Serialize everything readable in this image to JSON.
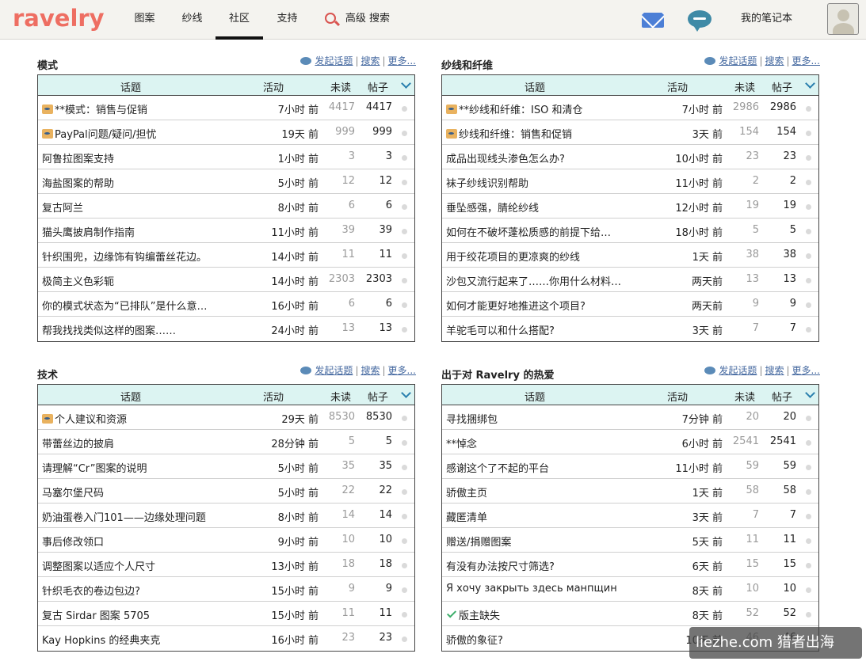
{
  "header": {
    "logo": "ravelry",
    "nav": [
      "图案",
      "纱线",
      "社区",
      "支持"
    ],
    "search_label": "高级 搜索",
    "notebook": "我的笔记本"
  },
  "links": {
    "start": "发起话题",
    "search": "搜索",
    "more": "更多..."
  },
  "cols": {
    "topic": "话题",
    "activity": "活动",
    "unread": "未读",
    "posts": "帖子"
  },
  "sections": [
    {
      "title": "模式",
      "rows": [
        {
          "t": "**模式：销售与促销",
          "a": "7小时 前",
          "u": "4417",
          "p": "4417",
          "pin": true
        },
        {
          "t": "PayPal问题/疑问/担忧",
          "a": "19天 前",
          "u": "999",
          "p": "999",
          "pin": true
        },
        {
          "t": "阿鲁拉图案支持",
          "a": "1小时 前",
          "u": "3",
          "p": "3"
        },
        {
          "t": "海盐图案的帮助",
          "a": "5小时 前",
          "u": "12",
          "p": "12"
        },
        {
          "t": "复古阿兰",
          "a": "8小时 前",
          "u": "6",
          "p": "6"
        },
        {
          "t": "猫头鹰披肩制作指南",
          "a": "11小时 前",
          "u": "39",
          "p": "39"
        },
        {
          "t": "针织围兜，边缘饰有钩编蕾丝花边。",
          "a": "14小时 前",
          "u": "11",
          "p": "11"
        },
        {
          "t": "极简主义色彩轭",
          "a": "14小时 前",
          "u": "2303",
          "p": "2303"
        },
        {
          "t": "你的模式状态为“已排队”是什么意…",
          "a": "16小时 前",
          "u": "6",
          "p": "6"
        },
        {
          "t": "帮我找找类似这样的图案……",
          "a": "24小时 前",
          "u": "13",
          "p": "13"
        }
      ]
    },
    {
      "title": "纱线和纤维",
      "rows": [
        {
          "t": "**纱线和纤维：ISO 和清仓",
          "a": "7小时 前",
          "u": "2986",
          "p": "2986",
          "pin": true
        },
        {
          "t": "纱线和纤维：销售和促销",
          "a": "3天 前",
          "u": "154",
          "p": "154",
          "pin": true
        },
        {
          "t": "成品出现线头渗色怎么办?",
          "a": "10小时 前",
          "u": "23",
          "p": "23"
        },
        {
          "t": "袜子纱线识别帮助",
          "a": "11小时 前",
          "u": "2",
          "p": "2"
        },
        {
          "t": "垂坠感强，腈纶纱线",
          "a": "12小时 前",
          "u": "19",
          "p": "19"
        },
        {
          "t": "如何在不破坏蓬松质感的前提下给…",
          "a": "18小时 前",
          "u": "5",
          "p": "5"
        },
        {
          "t": "用于绞花项目的更凉爽的纱线",
          "a": "1天 前",
          "u": "38",
          "p": "38"
        },
        {
          "t": "沙包又流行起来了……你用什么材料…",
          "a": "两天前",
          "u": "13",
          "p": "13"
        },
        {
          "t": "如何才能更好地推进这个项目?",
          "a": "两天前",
          "u": "9",
          "p": "9"
        },
        {
          "t": "羊驼毛可以和什么搭配?",
          "a": "3天 前",
          "u": "7",
          "p": "7"
        }
      ]
    },
    {
      "title": "技术",
      "rows": [
        {
          "t": "个人建议和资源",
          "a": "29天 前",
          "u": "8530",
          "p": "8530",
          "pin": true
        },
        {
          "t": "带蕾丝边的披肩",
          "a": "28分钟 前",
          "u": "5",
          "p": "5"
        },
        {
          "t": "请理解“Cr”图案的说明",
          "a": "5小时 前",
          "u": "35",
          "p": "35"
        },
        {
          "t": "马塞尔堡尺码",
          "a": "5小时 前",
          "u": "22",
          "p": "22"
        },
        {
          "t": "奶油蛋卷入门101——边缘处理问题",
          "a": "8小时 前",
          "u": "14",
          "p": "14"
        },
        {
          "t": "事后修改领口",
          "a": "9小时 前",
          "u": "10",
          "p": "10"
        },
        {
          "t": "调整图案以适应个人尺寸",
          "a": "13小时 前",
          "u": "18",
          "p": "18"
        },
        {
          "t": "针织毛衣的卷边包边?",
          "a": "15小时 前",
          "u": "9",
          "p": "9"
        },
        {
          "t": "复古 Sirdar 图案 5705",
          "a": "15小时 前",
          "u": "11",
          "p": "11"
        },
        {
          "t": "Kay Hopkins 的经典夹克",
          "a": "16小时 前",
          "u": "23",
          "p": "23"
        }
      ]
    },
    {
      "title": "出于对 Ravelry 的热爱",
      "rows": [
        {
          "t": "寻找捆绑包",
          "a": "7分钟 前",
          "u": "20",
          "p": "20"
        },
        {
          "t": "**悼念",
          "a": "6小时 前",
          "u": "2541",
          "p": "2541"
        },
        {
          "t": "感谢这个了不起的平台",
          "a": "11小时 前",
          "u": "59",
          "p": "59"
        },
        {
          "t": "骄傲主页",
          "a": "1天 前",
          "u": "58",
          "p": "58"
        },
        {
          "t": "藏匿清单",
          "a": "3天 前",
          "u": "7",
          "p": "7"
        },
        {
          "t": "赠送/捐赠图案",
          "a": "5天 前",
          "u": "11",
          "p": "11"
        },
        {
          "t": "有没有办法按尺寸筛选?",
          "a": "6天 前",
          "u": "15",
          "p": "15"
        },
        {
          "t": "Я хочу закрыть здесь манпщин",
          "a": "8天 前",
          "u": "10",
          "p": "10"
        },
        {
          "t": "版主缺失",
          "a": "8天 前",
          "u": "52",
          "p": "52",
          "check": true
        },
        {
          "t": "骄傲的象征?",
          "a": "10天 前",
          "u": "46",
          "p": "46"
        }
      ]
    }
  ],
  "watermark": "liezhe.com   猎者出海"
}
